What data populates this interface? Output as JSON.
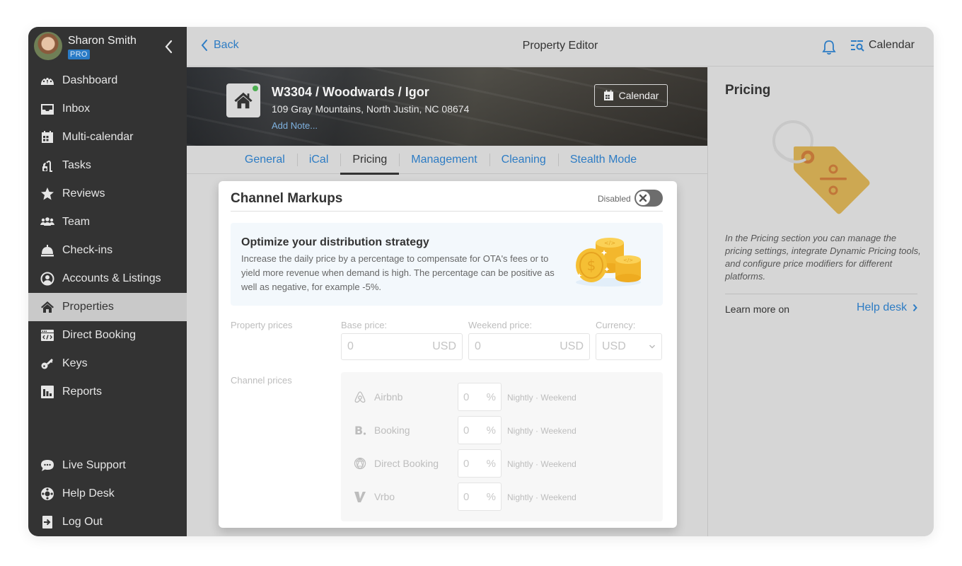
{
  "user": {
    "name": "Sharon Smith",
    "badge": "PRO"
  },
  "sidebar": {
    "items": [
      {
        "label": "Dashboard",
        "icon": "dashboard-gauge-icon"
      },
      {
        "label": "Inbox",
        "icon": "inbox-tray-icon"
      },
      {
        "label": "Multi-calendar",
        "icon": "calendar-grid-icon"
      },
      {
        "label": "Tasks",
        "icon": "vacuum-cleaner-icon"
      },
      {
        "label": "Reviews",
        "icon": "star-icon"
      },
      {
        "label": "Team",
        "icon": "people-icon"
      },
      {
        "label": "Check-ins",
        "icon": "service-bell-icon"
      },
      {
        "label": "Accounts & Listings",
        "icon": "user-circle-icon"
      },
      {
        "label": "Properties",
        "icon": "home-icon",
        "active": true
      },
      {
        "label": "Direct Booking",
        "icon": "code-window-icon"
      },
      {
        "label": "Keys",
        "icon": "key-icon"
      },
      {
        "label": "Reports",
        "icon": "bar-chart-icon"
      }
    ],
    "bottom_items": [
      {
        "label": "Live Support",
        "icon": "chat-bubble-icon"
      },
      {
        "label": "Help Desk",
        "icon": "lifebuoy-icon"
      },
      {
        "label": "Log Out",
        "icon": "logout-icon"
      }
    ]
  },
  "topbar": {
    "back_label": "Back",
    "title": "Property Editor",
    "calendar_label": "Calendar"
  },
  "property": {
    "title": "W3304 / Woodwards / Igor",
    "address": "109 Gray Mountains, North Justin, NC 08674",
    "add_note": "Add Note...",
    "calendar_button": "Calendar",
    "status_color": "#4caf50"
  },
  "tabs": [
    {
      "label": "General"
    },
    {
      "label": "iCal"
    },
    {
      "label": "Pricing",
      "active": true
    },
    {
      "label": "Management"
    },
    {
      "label": "Cleaning"
    },
    {
      "label": "Stealth Mode"
    }
  ],
  "card": {
    "title": "Channel Markups",
    "toggle_label": "Disabled",
    "toggle_on": false,
    "info": {
      "title": "Optimize your distribution strategy",
      "text": "Increase the daily price by a percentage to compensate for OTA's fees or to yield more revenue when demand is high. The percentage can be positive as well as negative, for example -5%."
    },
    "property_prices": {
      "row_label": "Property prices",
      "base_label": "Base price:",
      "base_value": "0",
      "base_unit": "USD",
      "weekend_label": "Weekend price:",
      "weekend_value": "0",
      "weekend_unit": "USD",
      "currency_label": "Currency:",
      "currency_value": "USD"
    },
    "channel_prices": {
      "row_label": "Channel prices",
      "channels": [
        {
          "name": "Airbnb",
          "icon": "airbnb-icon",
          "value": "0",
          "unit": "%",
          "suffix": "Nightly · Weekend"
        },
        {
          "name": "Booking",
          "icon": "booking-icon",
          "value": "0",
          "unit": "%",
          "suffix": "Nightly · Weekend"
        },
        {
          "name": "Direct Booking",
          "icon": "direct-booking-icon",
          "value": "0",
          "unit": "%",
          "suffix": "Nightly · Weekend"
        },
        {
          "name": "Vrbo",
          "icon": "vrbo-icon",
          "value": "0",
          "unit": "%",
          "suffix": "Nightly · Weekend"
        }
      ]
    }
  },
  "right_panel": {
    "title": "Pricing",
    "description": "In the Pricing section you can manage the pricing settings, integrate Dynamic Pricing tools, and configure price modifiers for different platforms.",
    "learn_more": "Learn more on",
    "help_link": "Help desk"
  },
  "colors": {
    "accent": "#2d7cc4",
    "sidebar_bg": "#333333",
    "active_item_bg": "#c9c9c9",
    "tag_color": "#cda852"
  }
}
